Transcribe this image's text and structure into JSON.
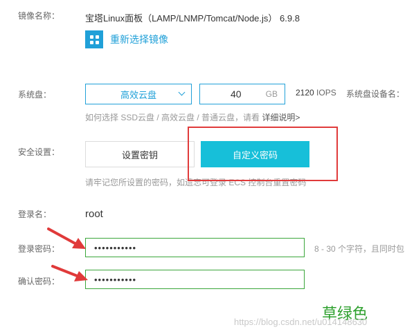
{
  "image": {
    "label": "镜像名称：",
    "name": "宝塔Linux面板（LAMP/LNMP/Tomcat/Node.js） 6.9.8",
    "reselect": "重新选择镜像",
    "icon": "grid-icon"
  },
  "disk": {
    "label": "系统盘：",
    "type": "高效云盘",
    "size": "40",
    "unit": "GB",
    "iops_value": "2120",
    "iops_unit": "IOPS",
    "device_label": "系统盘设备名：",
    "help_text": "如何选择 SSD云盘 / 高效云盘 / 普通云盘，请看",
    "help_link": "详细说明>"
  },
  "security": {
    "label": "安全设置：",
    "set_key": "设置密钥",
    "custom_password": "自定义密码",
    "hint": "请牢记您所设置的密码，如遗忘可登录 ECS 控制台重置密码"
  },
  "login": {
    "label": "登录名：",
    "value": "root"
  },
  "password": {
    "label": "登录密码：",
    "value": "•••••••••••",
    "hint": "8 - 30 个字符，且同时包"
  },
  "confirm": {
    "label": "确认密码：",
    "value": "•••••••••••"
  },
  "annotation": {
    "note": "草绿色",
    "watermark": "https://blog.csdn.net/u014148630"
  },
  "colors": {
    "accent": "#20a0d8",
    "primary_button": "#17bfd9",
    "annotation_red": "#e03a3a",
    "input_green": "#3aa63a"
  }
}
